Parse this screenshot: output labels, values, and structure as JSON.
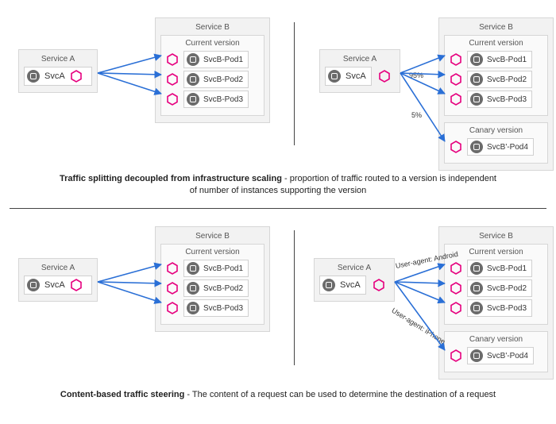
{
  "serviceA_label": "Service A",
  "serviceB_label": "Service B",
  "svcA_name": "SvcA",
  "current_version_label": "Current version",
  "canary_version_label": "Canary  version",
  "pods": {
    "p1": "SvcB-Pod1",
    "p2": "SvcB-Pod2",
    "p3": "SvcB-Pod3",
    "p4": "SvcB'-Pod4"
  },
  "labels": {
    "pct95": "95%",
    "pct5": "5%",
    "android": "User-agent: Android",
    "iphone": "User-agent: iPhone"
  },
  "caption1_bold": "Traffic splitting decoupled from infrastructure scaling",
  "caption1_rest": " - proportion of traffic routed to a version is independent of number of instances supporting the version",
  "caption2_bold": "Content-based traffic steering",
  "caption2_rest": " - The content of a request can be used to determine the destination of a request",
  "chart_data": [
    {
      "type": "diagram",
      "title": "Traffic splitting decoupled from infrastructure scaling",
      "left": {
        "source": "SvcA",
        "targets": [
          {
            "version": "Current version",
            "pods": [
              "SvcB-Pod1",
              "SvcB-Pod2",
              "SvcB-Pod3"
            ],
            "weight": null
          }
        ]
      },
      "right": {
        "source": "SvcA",
        "targets": [
          {
            "version": "Current version",
            "pods": [
              "SvcB-Pod1",
              "SvcB-Pod2",
              "SvcB-Pod3"
            ],
            "weight": "95%"
          },
          {
            "version": "Canary version",
            "pods": [
              "SvcB'-Pod4"
            ],
            "weight": "5%"
          }
        ]
      }
    },
    {
      "type": "diagram",
      "title": "Content-based traffic steering",
      "left": {
        "source": "SvcA",
        "targets": [
          {
            "version": "Current version",
            "pods": [
              "SvcB-Pod1",
              "SvcB-Pod2",
              "SvcB-Pod3"
            ],
            "condition": null
          }
        ]
      },
      "right": {
        "source": "SvcA",
        "targets": [
          {
            "version": "Current version",
            "pods": [
              "SvcB-Pod1",
              "SvcB-Pod2",
              "SvcB-Pod3"
            ],
            "condition": "User-agent: Android"
          },
          {
            "version": "Canary version",
            "pods": [
              "SvcB'-Pod4"
            ],
            "condition": "User-agent: iPhone"
          }
        ]
      }
    }
  ]
}
